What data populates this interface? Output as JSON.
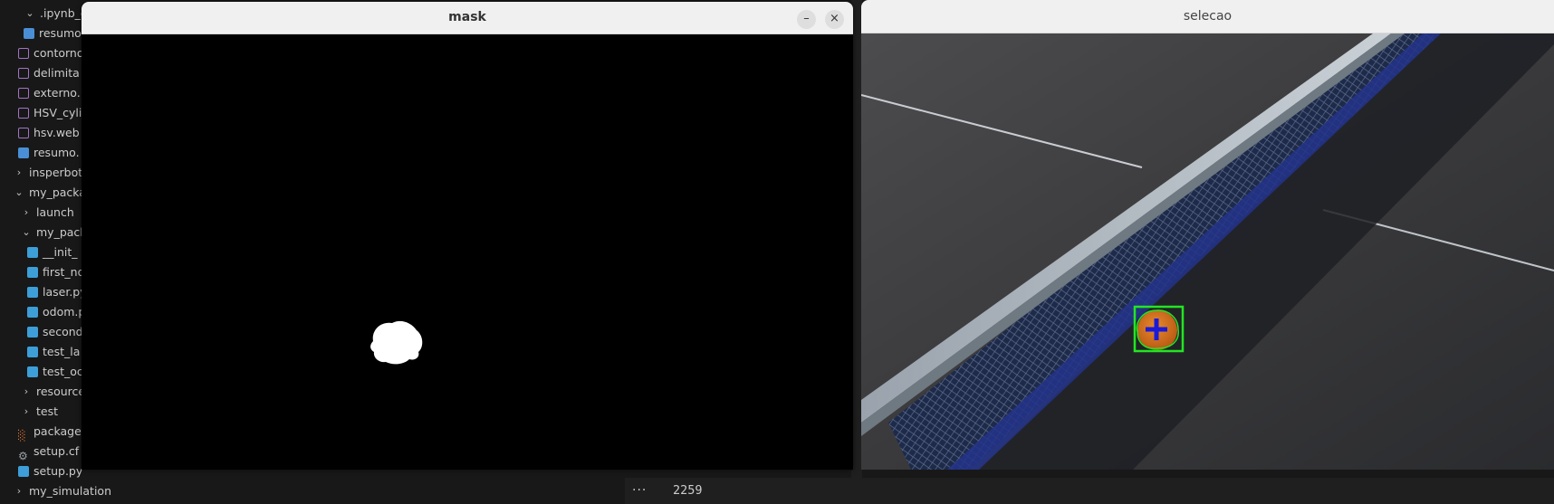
{
  "explorer": {
    "items": [
      {
        "label": ".ipynb_c",
        "chevron": "down",
        "icon": "none"
      },
      {
        "label": "resumo",
        "chevron": "",
        "icon": "doc"
      },
      {
        "label": "contorno",
        "chevron": "",
        "icon": "img"
      },
      {
        "label": "delimita",
        "chevron": "",
        "icon": "img"
      },
      {
        "label": "externo.",
        "chevron": "",
        "icon": "img"
      },
      {
        "label": "HSV_cyli",
        "chevron": "",
        "icon": "img"
      },
      {
        "label": "hsv.web",
        "chevron": "",
        "icon": "img"
      },
      {
        "label": "resumo.",
        "chevron": "",
        "icon": "doc"
      },
      {
        "label": "insperbot",
        "chevron": "right",
        "icon": "none"
      },
      {
        "label": "my_packa",
        "chevron": "down",
        "icon": "none"
      },
      {
        "label": "launch",
        "chevron": "right",
        "icon": "none"
      },
      {
        "label": "my_pack",
        "chevron": "down",
        "icon": "none"
      },
      {
        "label": "__init_",
        "chevron": "",
        "icon": "py"
      },
      {
        "label": "first_no",
        "chevron": "",
        "icon": "py"
      },
      {
        "label": "laser.py",
        "chevron": "",
        "icon": "py"
      },
      {
        "label": "odom.p",
        "chevron": "",
        "icon": "py"
      },
      {
        "label": "second",
        "chevron": "",
        "icon": "py"
      },
      {
        "label": "test_la",
        "chevron": "",
        "icon": "py"
      },
      {
        "label": "test_oc",
        "chevron": "",
        "icon": "py"
      },
      {
        "label": "resource",
        "chevron": "right",
        "icon": "none"
      },
      {
        "label": "test",
        "chevron": "right",
        "icon": "none"
      },
      {
        "label": "package",
        "chevron": "",
        "icon": "rss"
      },
      {
        "label": "setup.cf",
        "chevron": "",
        "icon": "gear"
      },
      {
        "label": "setup.py",
        "chevron": "",
        "icon": "py"
      },
      {
        "label": "my_simulation",
        "chevron": "right",
        "icon": "none"
      }
    ]
  },
  "bottom_bar": {
    "dots": "···",
    "value": "2259"
  },
  "mask_window": {
    "title": "mask",
    "minimize": "–",
    "close": "×"
  },
  "selecao_window": {
    "title": "selecao"
  },
  "colors": {
    "detection_box": "#22e622",
    "crosshair": "#1a1ad8",
    "ball": "#d9701c"
  }
}
